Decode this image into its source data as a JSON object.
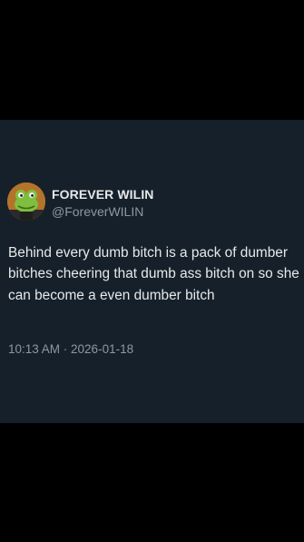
{
  "author": {
    "display_name": "FOREVER WILIN",
    "handle": "@ForeverWILIN",
    "avatar_icon": "frog-avatar"
  },
  "tweet": {
    "text": "Behind every dumb bitch is a pack of dumber bitches cheering that dumb ass bitch on so she can become a even dumber bitch",
    "timestamp": "10:13 AM · 2026-01-18"
  },
  "colors": {
    "card_background": "#16202a",
    "primary_text": "#e7e9ea",
    "secondary_text": "#8b98a5",
    "letterbox": "#000000"
  }
}
